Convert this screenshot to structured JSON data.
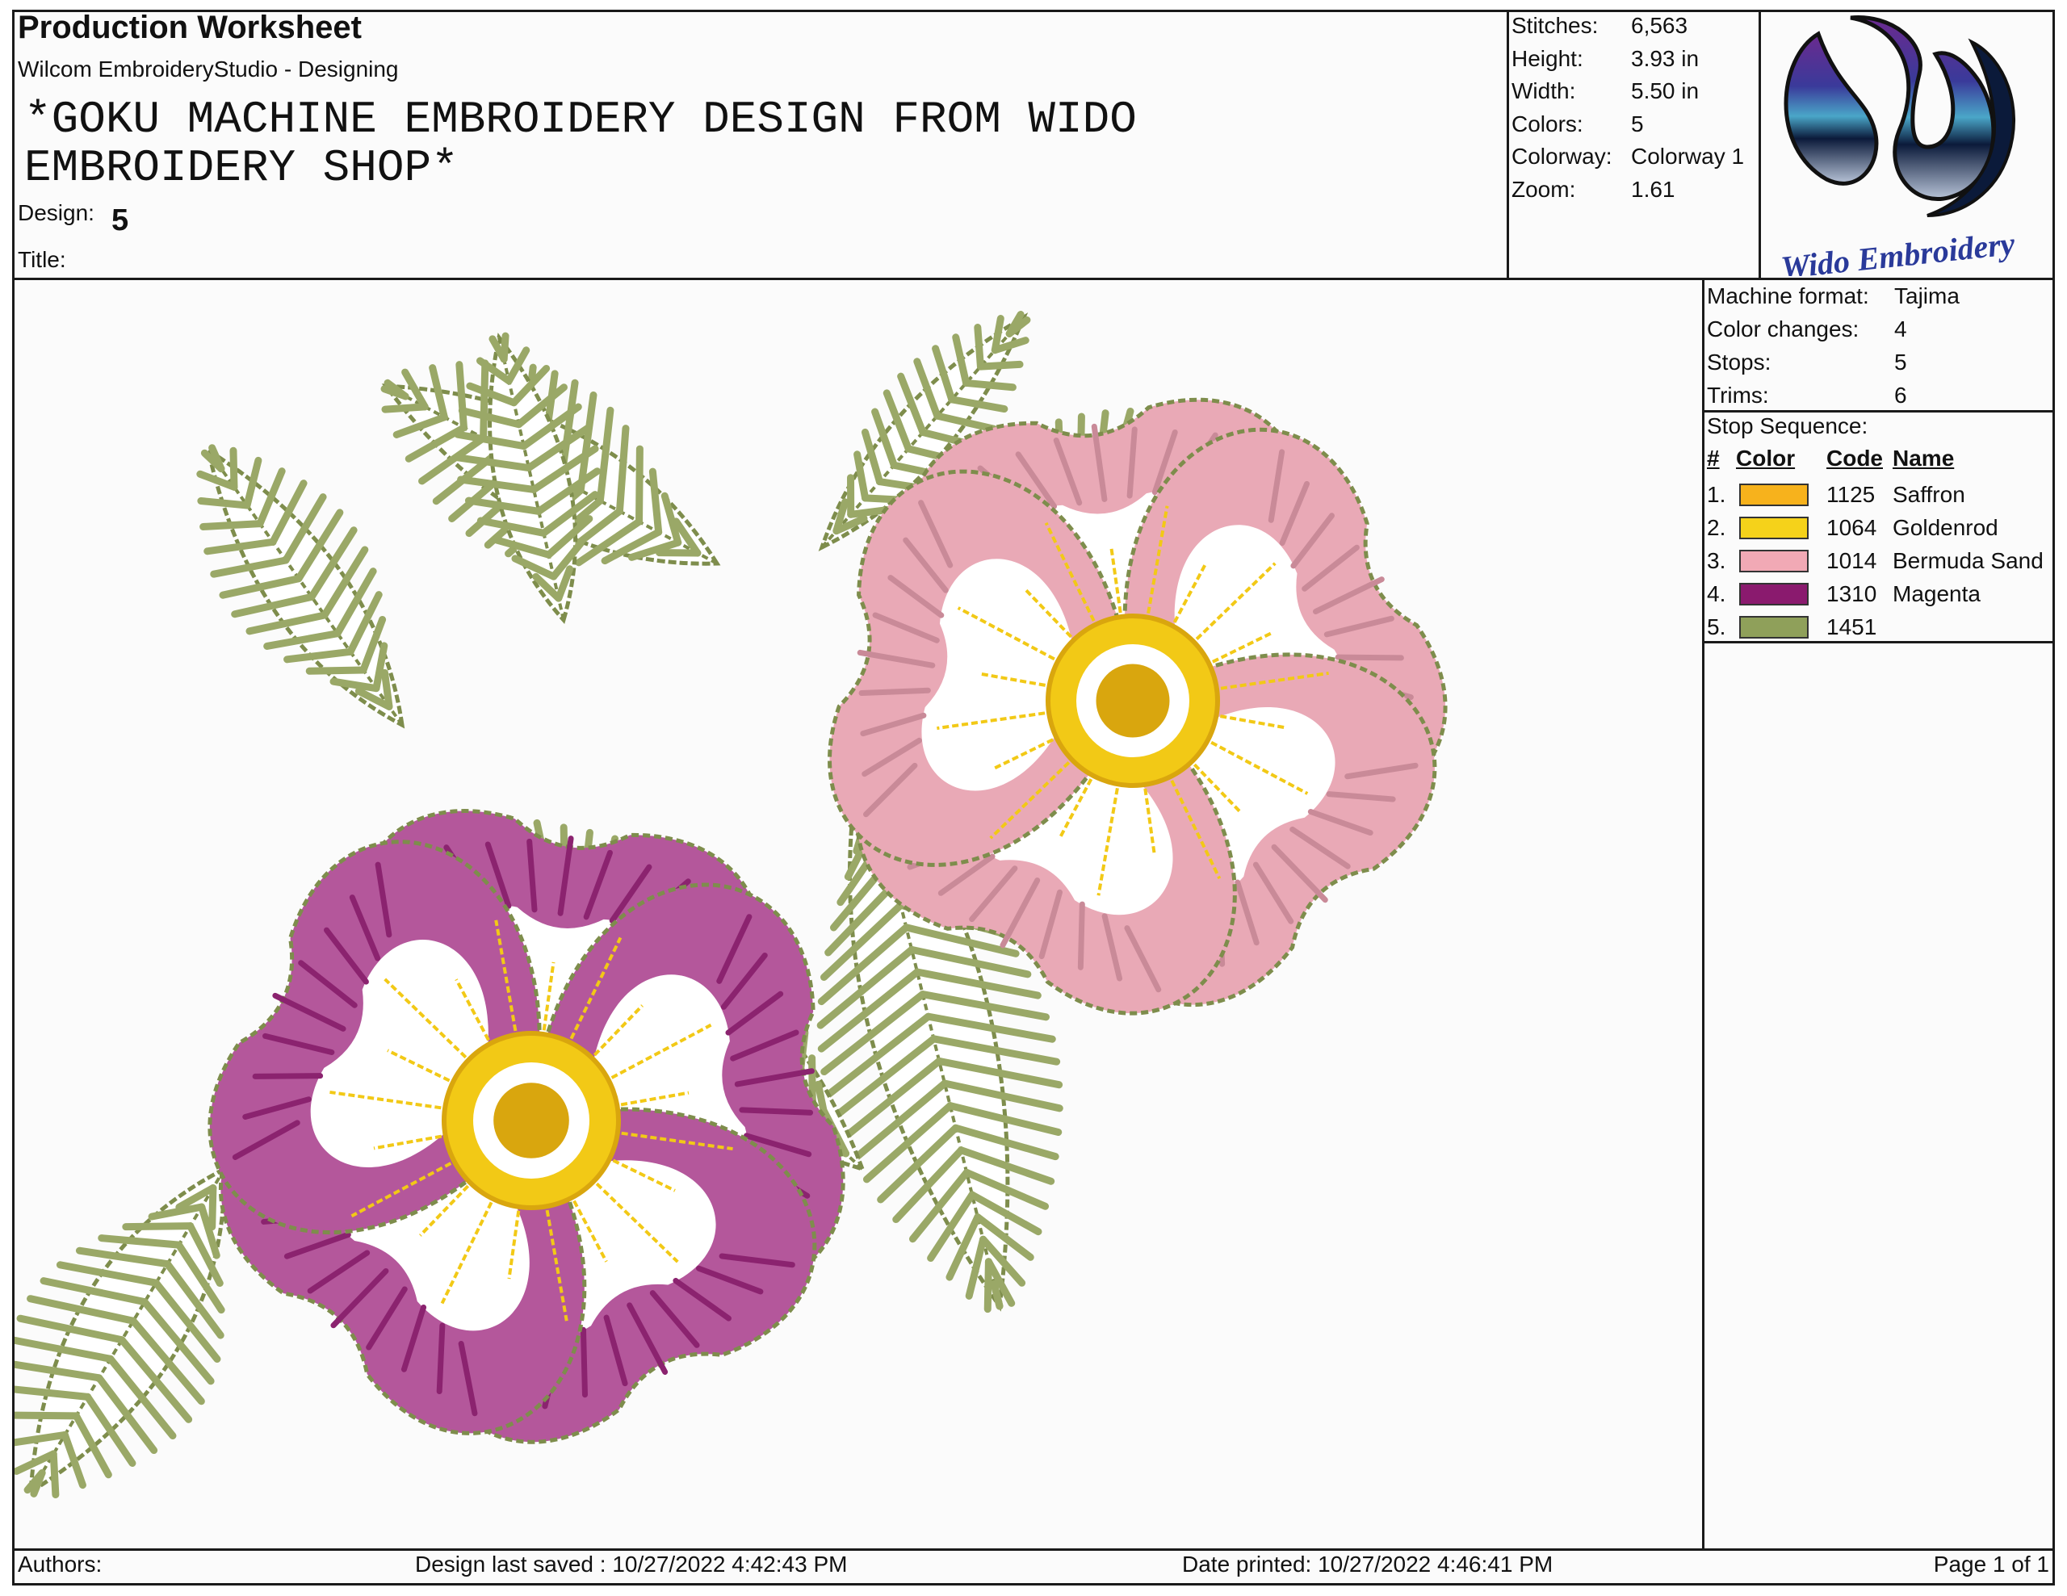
{
  "header": {
    "doc_title": "Production Worksheet",
    "app_name": "Wilcom EmbroideryStudio - Designing",
    "design_name": "*GOKU MACHINE EMBROIDERY DESIGN FROM WIDO EMBROIDERY SHOP*",
    "design_label": "Design:",
    "design_value": "5",
    "title_label": "Title:"
  },
  "stats": [
    {
      "label": "Stitches:",
      "value": "6,563"
    },
    {
      "label": "Height:",
      "value": "3.93 in"
    },
    {
      "label": "Width:",
      "value": "5.50 in"
    },
    {
      "label": "Colors:",
      "value": "5"
    },
    {
      "label": "Colorway:",
      "value": "Colorway 1"
    },
    {
      "label": "Zoom:",
      "value": "1.61"
    }
  ],
  "logo": {
    "text": "Wido Embroidery"
  },
  "machine": [
    {
      "label": "Machine format:",
      "value": "Tajima"
    },
    {
      "label": "Color changes:",
      "value": "4"
    },
    {
      "label": "Stops:",
      "value": "5"
    },
    {
      "label": "Trims:",
      "value": "6"
    }
  ],
  "stop_sequence": {
    "label": "Stop Sequence:",
    "headers": {
      "num": "#",
      "color": "Color",
      "code": "Code",
      "name": "Name"
    },
    "rows": [
      {
        "num": "1.",
        "color": "#f7b21c",
        "code": "1125",
        "name": "Saffron"
      },
      {
        "num": "2.",
        "color": "#f5d21a",
        "code": "1064",
        "name": "Goldenrod"
      },
      {
        "num": "3.",
        "color": "#f1a9b5",
        "code": "1014",
        "name": "Bermuda Sand"
      },
      {
        "num": "4.",
        "color": "#8a1a6e",
        "code": "1310",
        "name": "Magenta"
      },
      {
        "num": "5.",
        "color": "#8fa05a",
        "code": "1451",
        "name": ""
      }
    ]
  },
  "footer": {
    "authors": "Authors:",
    "last_saved": "Design last saved : 10/27/2022 4:42:43 PM",
    "printed": "Date printed: 10/27/2022 4:46:41 PM",
    "page": "Page 1 of 1"
  },
  "colors": {
    "leaf": "#9aa867",
    "leaf_dark": "#7e8d4c",
    "pink": "#e9a9b6",
    "pink_dark": "#c98a98",
    "magenta": "#8b236f",
    "magenta_light": "#b4579b",
    "yellow": "#f2c916",
    "yellow_dark": "#d9a60e"
  }
}
